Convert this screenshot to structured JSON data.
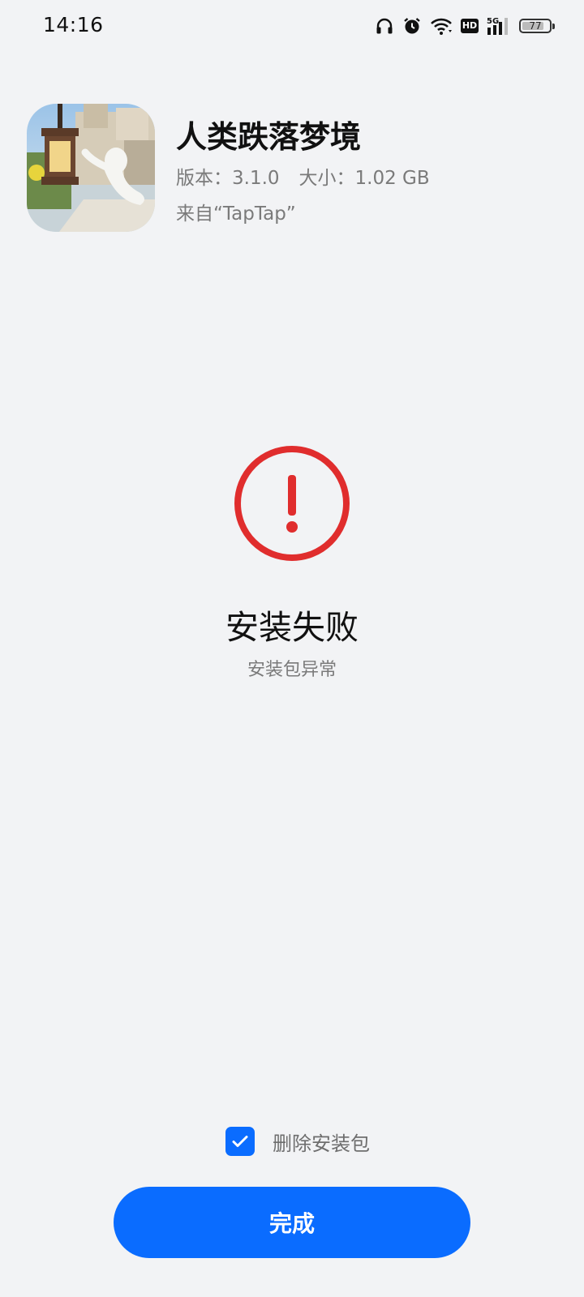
{
  "status_bar": {
    "time": "14:16",
    "network": "5G",
    "hd_badge": "HD",
    "battery_level": "77",
    "icons": [
      "headphones-icon",
      "alarm-icon",
      "wifi-icon",
      "hd-icon",
      "signal-icon",
      "battery-icon"
    ]
  },
  "app": {
    "name": "人类跌落梦境",
    "version_text": "版本：3.1.0",
    "size_text": "大小：1.02 GB",
    "source_text": "来自“TapTap”"
  },
  "status": {
    "icon": "error-exclamation-icon",
    "title": "安装失败",
    "subtitle": "安装包异常",
    "color": "#e02d2d"
  },
  "options": {
    "delete_package_label": "删除安装包",
    "delete_package_checked": true
  },
  "actions": {
    "done_label": "完成"
  },
  "colors": {
    "accent": "#0a6cff",
    "error": "#e02d2d",
    "background": "#f2f3f5"
  }
}
